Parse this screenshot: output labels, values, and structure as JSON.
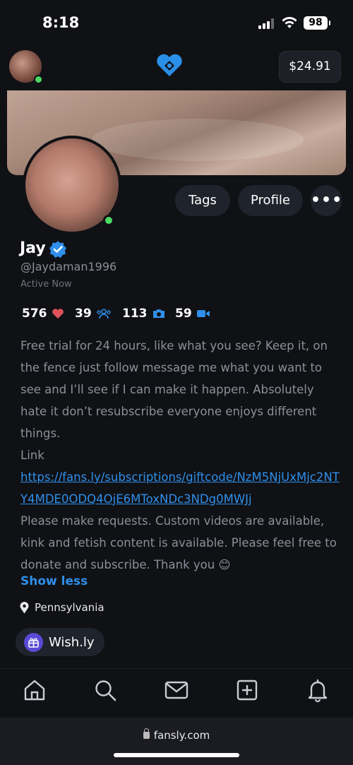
{
  "status_bar": {
    "time": "8:18",
    "battery": "98"
  },
  "header": {
    "balance": "$24.91"
  },
  "profile": {
    "name": "Jay",
    "username": "@Jaydaman1996",
    "active_status": "Active Now",
    "buttons": {
      "tags": "Tags",
      "profile": "Profile",
      "more": "•••"
    }
  },
  "stats": {
    "likes": "576",
    "subscribers": "39",
    "photos": "113",
    "videos": "59"
  },
  "bio": {
    "paragraph1": "Free trial for 24 hours, like what you see? Keep it, on the fence just follow message me what you want to see and I’ll see if I can make it happen. Absolutely hate it don’t resubscribe everyone enjoys different things.",
    "link_label": "Link",
    "link_url": "https://fans.ly/subscriptions/giftcode/NzM5NjUxMjc2NTY4MDE0ODQ4OjE6MToxNDc3NDg0MWJj",
    "paragraph2": " Please make requests. Custom videos are available, kink and fetish content is available. Please feel free to donate and subscribe. Thank you 😊",
    "show_less": "Show less"
  },
  "location": "Pennsylvania",
  "wishlist": {
    "label": "Wish.ly"
  },
  "browser": {
    "url": "fansly.com"
  },
  "colors": {
    "accent": "#2f8fea",
    "online": "#4cd964",
    "heart": "#e0525b"
  },
  "icons": [
    "signal-icon",
    "wifi-icon",
    "heart-icon",
    "users-icon",
    "camera-icon",
    "video-icon",
    "verified-icon",
    "location-pin-icon",
    "home-icon",
    "search-icon",
    "mail-icon",
    "plus-square-icon",
    "bell-icon",
    "lock-icon"
  ]
}
